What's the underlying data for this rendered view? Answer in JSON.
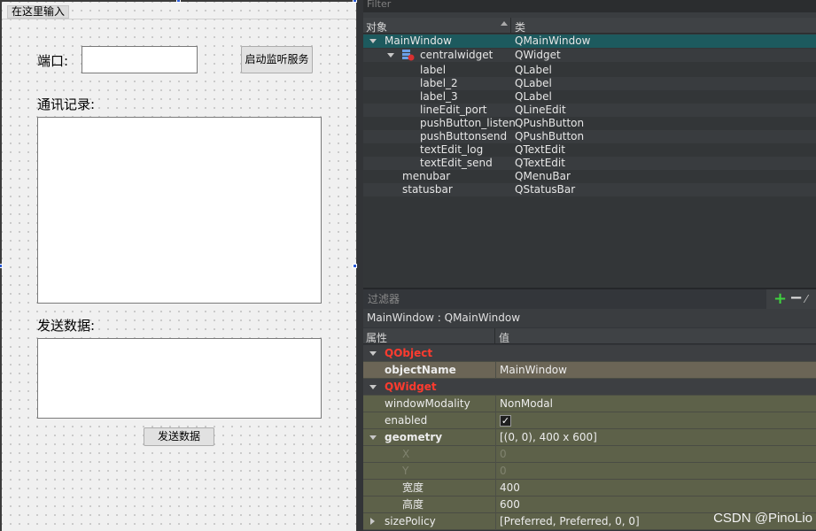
{
  "designer": {
    "menubar_placeholder": "在这里输入",
    "label_port": "端口:",
    "port_value": "",
    "button_listen": "启动监听服务",
    "label_log": "通讯记录:",
    "label_send": "发送数据:",
    "button_send": "发送数据"
  },
  "object_inspector": {
    "filter_placeholder": "Filter",
    "col_object": "对象",
    "col_class": "类",
    "rows": [
      {
        "name": "MainWindow",
        "class": "QMainWindow"
      },
      {
        "name": "centralwidget",
        "class": "QWidget"
      },
      {
        "name": "label",
        "class": "QLabel"
      },
      {
        "name": "label_2",
        "class": "QLabel"
      },
      {
        "name": "label_3",
        "class": "QLabel"
      },
      {
        "name": "lineEdit_port",
        "class": "QLineEdit"
      },
      {
        "name": "pushButton_listen",
        "class": "QPushButton"
      },
      {
        "name": "pushButtonsend",
        "class": "QPushButton"
      },
      {
        "name": "textEdit_log",
        "class": "QTextEdit"
      },
      {
        "name": "textEdit_send",
        "class": "QTextEdit"
      },
      {
        "name": "menubar",
        "class": "QMenuBar"
      },
      {
        "name": "statusbar",
        "class": "QStatusBar"
      }
    ]
  },
  "property_editor": {
    "filter_placeholder": "过滤器",
    "object_line": "MainWindow : QMainWindow",
    "col_property": "属性",
    "col_value": "值",
    "section_qobject": "QObject",
    "prop_objectName": {
      "name": "objectName",
      "value": "MainWindow"
    },
    "section_qwidget": "QWidget",
    "prop_windowModality": {
      "name": "windowModality",
      "value": "NonModal"
    },
    "prop_enabled": {
      "name": "enabled",
      "value": "✓"
    },
    "prop_geometry": {
      "name": "geometry",
      "value": "[(0, 0), 400 x 600]"
    },
    "prop_x": {
      "name": "X",
      "value": "0"
    },
    "prop_y": {
      "name": "Y",
      "value": "0"
    },
    "prop_width": {
      "name": "宽度",
      "value": "400"
    },
    "prop_height": {
      "name": "高度",
      "value": "600"
    },
    "prop_sizePolicy": {
      "name": "sizePolicy",
      "value": "[Preferred, Preferred, 0, 0]"
    }
  },
  "watermark": "CSDN @PinoLio",
  "icons": {
    "add": "plus-icon",
    "remove": "minus-icon",
    "configure": "wrench-icon",
    "widget": "widget-icon"
  }
}
